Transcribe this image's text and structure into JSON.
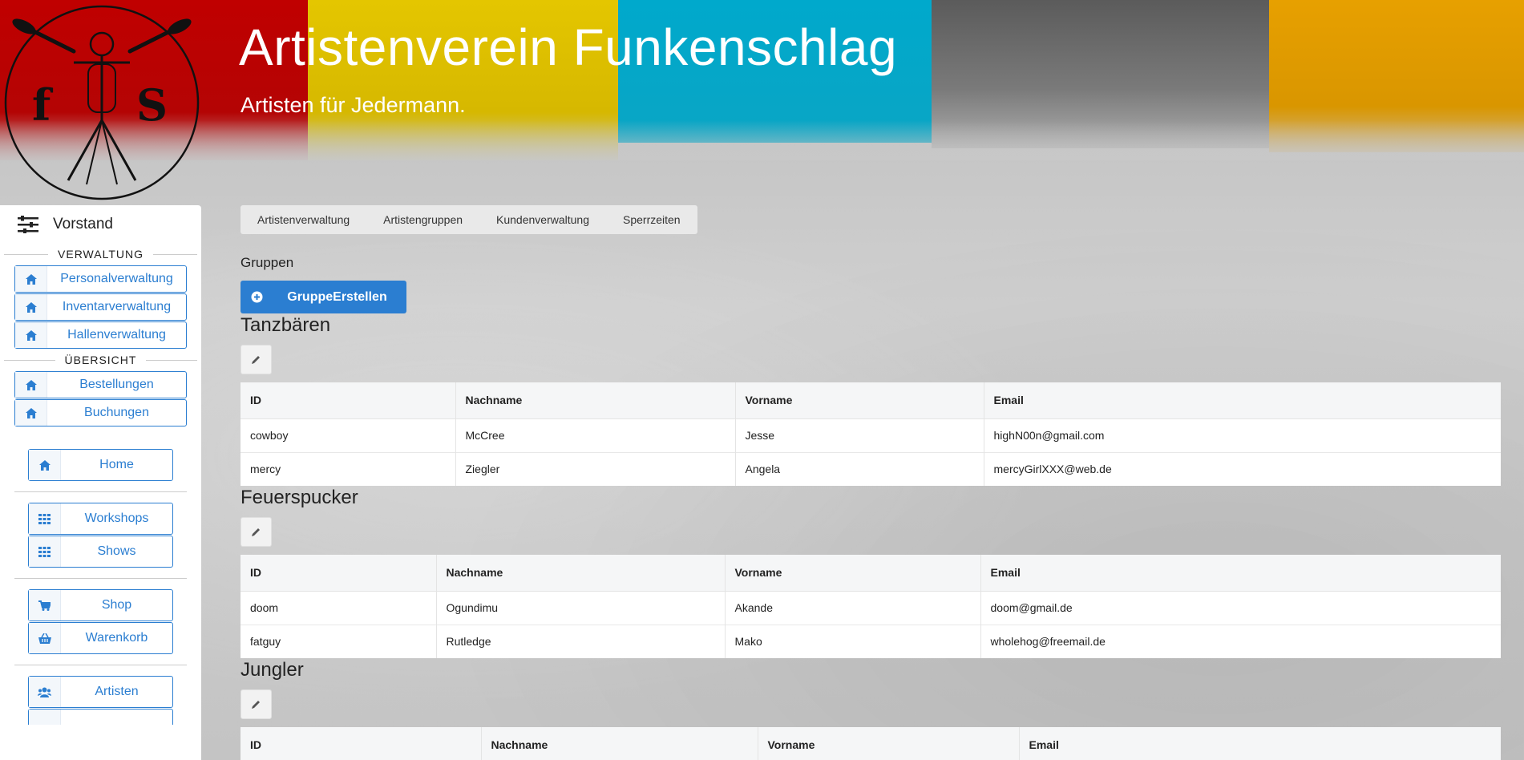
{
  "header": {
    "title": "Artistenverein Funkenschlag",
    "subtitle": "Artisten für Jedermann."
  },
  "sidebar": {
    "heading": "Vorstand",
    "section_verwaltung": "VERWALTUNG",
    "verwaltung_items": [
      {
        "label": "Personalverwaltung",
        "icon": "home-icon"
      },
      {
        "label": "Inventarverwaltung",
        "icon": "home-icon"
      },
      {
        "label": "Hallenverwaltung",
        "icon": "home-icon"
      }
    ],
    "section_uebersicht": "ÜBERSICHT",
    "uebersicht_items": [
      {
        "label": "Bestellungen",
        "icon": "home-icon"
      },
      {
        "label": "Buchungen",
        "icon": "home-icon"
      }
    ],
    "nav_items": [
      {
        "label": "Home",
        "icon": "home-icon"
      },
      {
        "label": "Workshops",
        "icon": "grid-icon"
      },
      {
        "label": "Shows",
        "icon": "grid-icon"
      },
      {
        "label": "Shop",
        "icon": "cart-icon"
      },
      {
        "label": "Warenkorb",
        "icon": "basket-icon"
      },
      {
        "label": "Artisten",
        "icon": "users-icon"
      }
    ]
  },
  "tabs": [
    "Artistenverwaltung",
    "Artistengruppen",
    "Kundenverwaltung",
    "Sperrzeiten"
  ],
  "main": {
    "section_label": "Gruppen",
    "create_button": "GruppeErstellen"
  },
  "table_headers": [
    "ID",
    "Nachname",
    "Vorname",
    "Email"
  ],
  "groups": [
    {
      "name": "Tanzbären",
      "rows": [
        [
          "cowboy",
          "McCree",
          "Jesse",
          "highN00n@gmail.com"
        ],
        [
          "mercy",
          "Ziegler",
          "Angela",
          "mercyGirlXXX@web.de"
        ]
      ]
    },
    {
      "name": "Feuerspucker",
      "rows": [
        [
          "doom",
          "Ogundimu",
          "Akande",
          "doom@gmail.de"
        ],
        [
          "fatguy",
          "Rutledge",
          "Mako",
          "wholehog@freemail.de"
        ]
      ]
    },
    {
      "name": "Jungler",
      "rows": []
    }
  ],
  "colors": {
    "accent": "#2b7ed1",
    "red": "#c00000",
    "yellow": "#e4c600",
    "cyan": "#00a9cc",
    "dark_grey": "#5b5b5b",
    "orange": "#e7a000"
  }
}
